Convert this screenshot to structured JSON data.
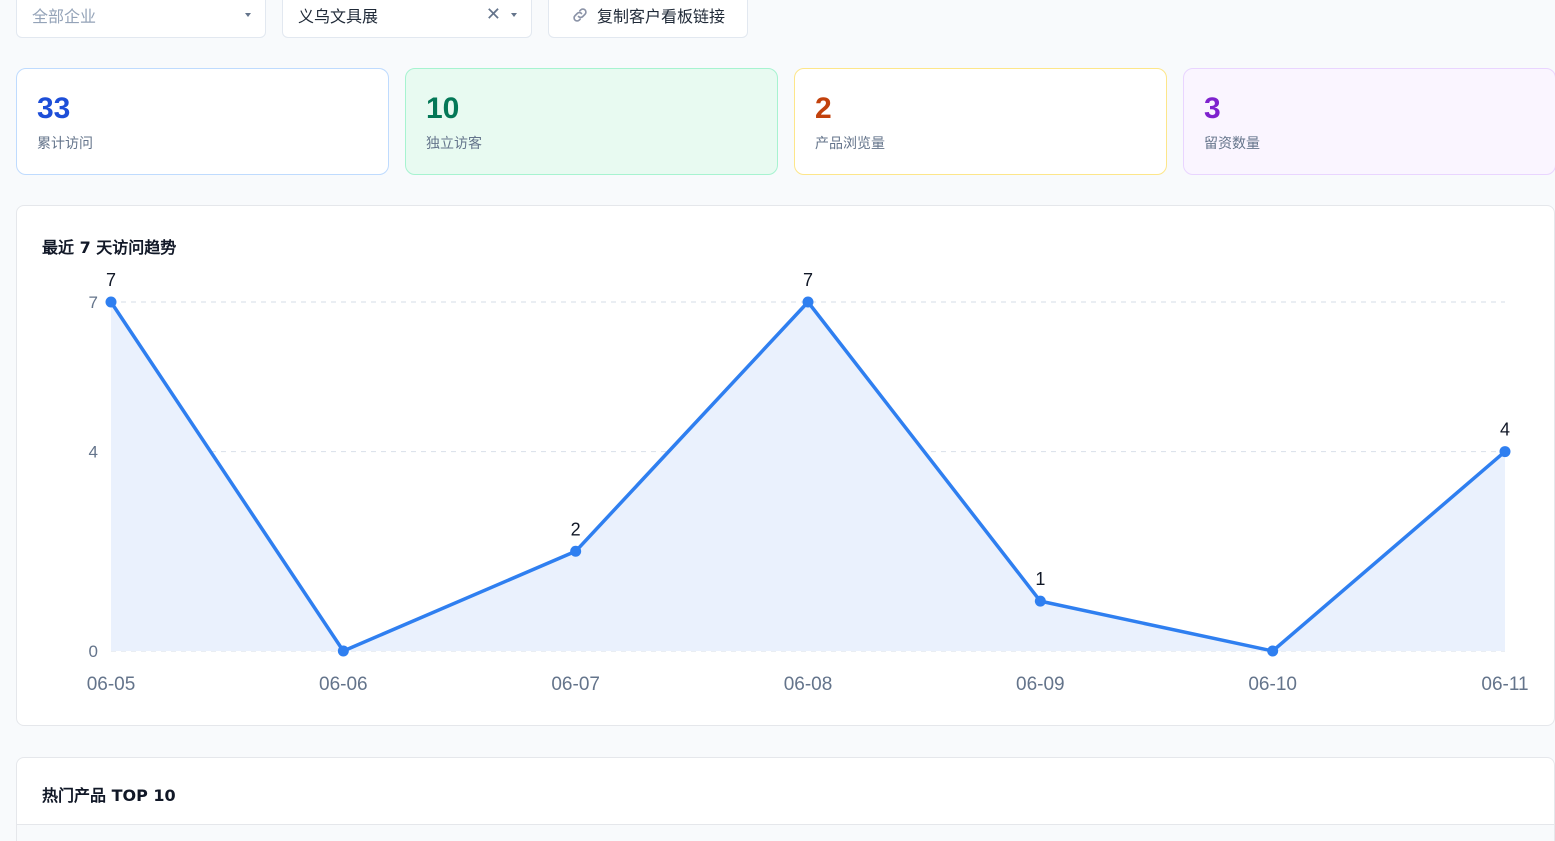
{
  "filters": {
    "company_select": {
      "placeholder": "全部企业"
    },
    "exhibition_select": {
      "value": "义乌文具展"
    },
    "copy_link_label": "复制客户看板链接"
  },
  "stats": [
    {
      "value": "33",
      "label": "累计访问",
      "color": "#1d4ed8"
    },
    {
      "value": "10",
      "label": "独立访客",
      "color": "#047857"
    },
    {
      "value": "2",
      "label": "产品浏览量",
      "color": "#c2410c"
    },
    {
      "value": "3",
      "label": "留资数量",
      "color": "#7e22ce"
    }
  ],
  "trend": {
    "title": "最近 7 天访问趋势"
  },
  "chart_data": {
    "type": "area",
    "title": "最近 7 天访问趋势",
    "categories": [
      "06-05",
      "06-06",
      "06-07",
      "06-08",
      "06-09",
      "06-10",
      "06-11"
    ],
    "values": [
      7,
      0,
      2,
      7,
      1,
      0,
      4
    ],
    "y_ticks": [
      "0",
      "4",
      "7"
    ],
    "ylim": [
      0,
      7
    ],
    "grid": true,
    "line_color": "#2f7ff0",
    "fill_color": "#eaf1fd"
  },
  "top_products": {
    "title": "热门产品 TOP 10"
  }
}
